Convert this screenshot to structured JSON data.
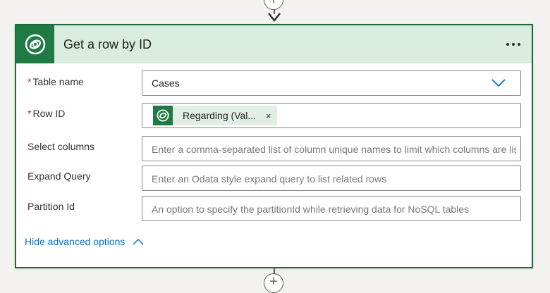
{
  "flow": {
    "add_step_symbol": "+"
  },
  "card": {
    "title": "Get a row by ID",
    "app_icon": "dataverse-icon",
    "menu_icon": "more-options-icon",
    "header_color": "#d9ece0",
    "accent_color": "#1e7b43"
  },
  "fields": {
    "table_name": {
      "label": "Table name",
      "required_mark": "*",
      "value": "Cases",
      "control": "dropdown"
    },
    "row_id": {
      "label": "Row ID",
      "required_mark": "*",
      "token": {
        "label": "Regarding (Val...",
        "remove": "×",
        "icon": "dataverse-icon"
      }
    },
    "select_columns": {
      "label": "Select columns",
      "placeholder": "Enter a comma-separated list of column unique names to limit which columns are listed"
    },
    "expand_query": {
      "label": "Expand Query",
      "placeholder": "Enter an Odata style expand query to list related rows"
    },
    "partition_id": {
      "label": "Partition Id",
      "placeholder": "An option to specify the partitionId while retrieving data for NoSQL tables"
    }
  },
  "advanced_toggle": {
    "label": "Hide advanced options",
    "icon": "chevron-up-icon"
  }
}
